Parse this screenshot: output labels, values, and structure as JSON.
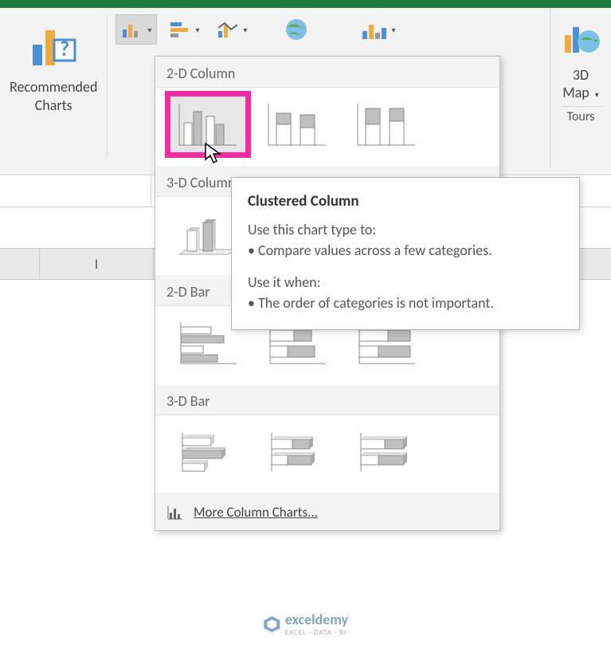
{
  "ribbon": {
    "recommended_label_l1": "Recommended",
    "recommended_label_l2": "Charts",
    "map3d_label": "3D",
    "map3d_sub": "Map",
    "tours_label": "Tours"
  },
  "gallery": {
    "sections": {
      "s2dcol": "2-D Column",
      "s3dcol": "3-D Column",
      "s2dbar": "2-D Bar",
      "s3dbar": "3-D Bar"
    },
    "more_label": "More Column Charts..."
  },
  "tooltip": {
    "title": "Clustered Column",
    "l1": "Use this chart type to:",
    "l2": "• Compare values across a few categories.",
    "l3": "Use it when:",
    "l4": "• The order of categories is not important."
  },
  "sheet": {
    "col_i": "I"
  },
  "watermark": {
    "brand": "exceldemy",
    "tag": "EXCEL · DATA · BI"
  }
}
